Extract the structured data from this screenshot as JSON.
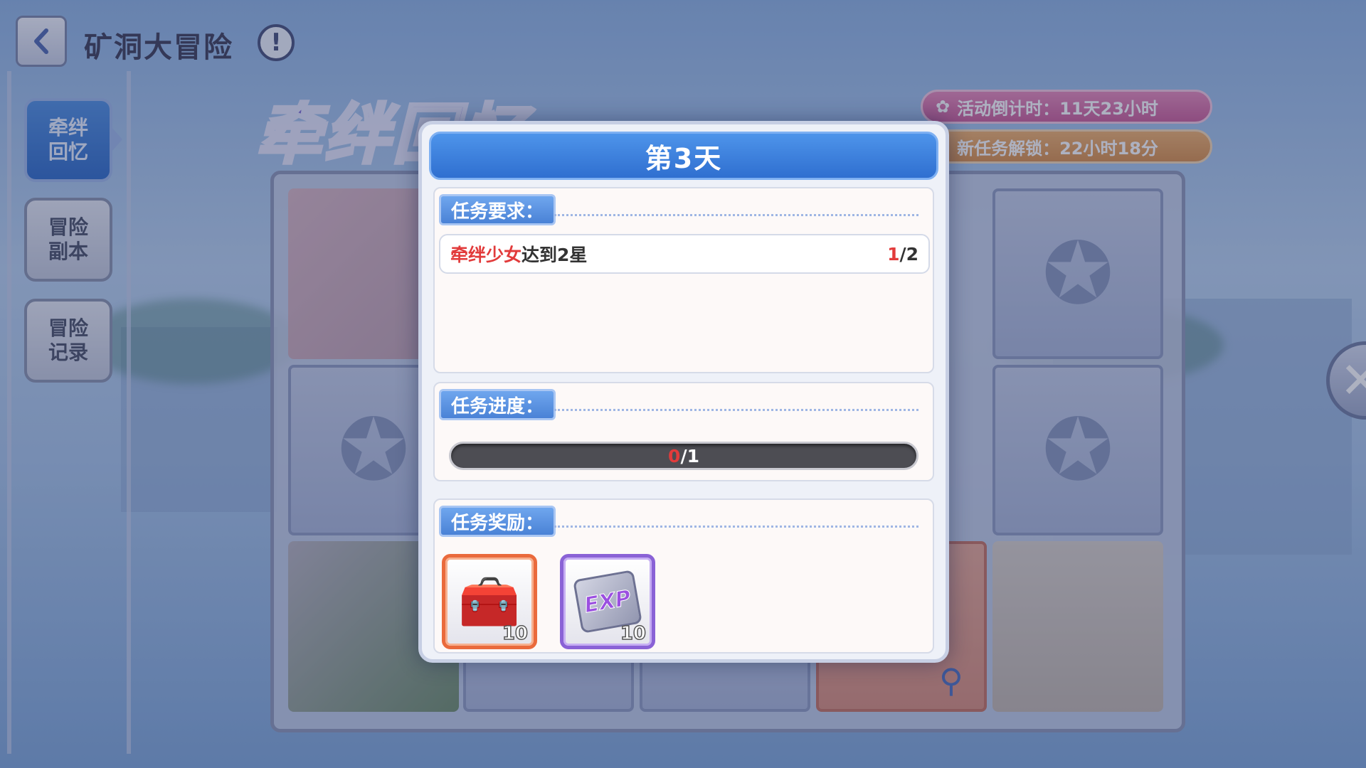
{
  "topbar": {
    "back_icon": "chevron-left-icon",
    "title": "矿洞大冒险",
    "info_label": "!"
  },
  "sidebar": {
    "items": [
      {
        "label": "牵绊\n回忆",
        "active": true
      },
      {
        "label": "冒险\n副本",
        "active": false
      },
      {
        "label": "冒险\n记录",
        "active": false
      }
    ]
  },
  "banner": {
    "title": "牵绊回忆"
  },
  "timers": {
    "countdown": "活动倒计时：11天23小时",
    "unlock": "新任务解锁：22小时18分"
  },
  "modal": {
    "title": "第3天",
    "requirement": {
      "tag": "任务要求：",
      "highlight": "牵绊少女",
      "text": "达到2星",
      "current": "1",
      "total": "/2"
    },
    "progress": {
      "tag": "任务进度：",
      "current": "0",
      "total": "/1",
      "fraction": 0
    },
    "rewards": {
      "tag": "任务奖励：",
      "items": [
        {
          "icon": "chest-icon",
          "count": "10",
          "frame_color": "#ea6a3c"
        },
        {
          "icon": "exp-icon",
          "label": "EXP",
          "count": "10",
          "frame_color": "#8a62d6"
        }
      ]
    }
  },
  "colors": {
    "accent_blue": "#2f6fd0",
    "highlight_red": "#e23b3b",
    "timer_pink": "#cc5d97",
    "timer_orange": "#d98f49"
  }
}
